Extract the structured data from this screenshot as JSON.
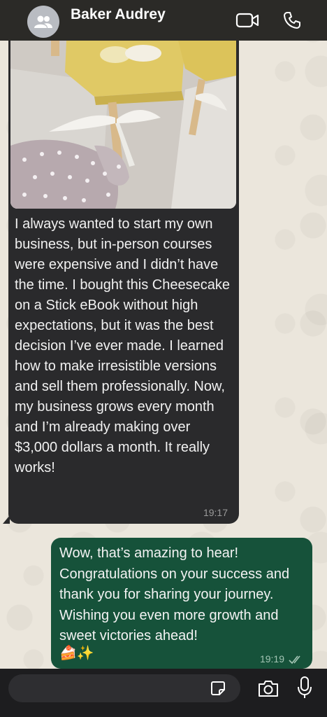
{
  "header": {
    "contact_name": "Baker Audrey",
    "icons": [
      "group-avatar-icon",
      "video-call-icon",
      "phone-call-icon"
    ]
  },
  "messages": [
    {
      "direction": "incoming",
      "has_photo": true,
      "photo_description_icon": "cheesecake-on-stick-photo",
      "text": "I always wanted to start my own business, but in-person courses were expensive and I didn’t have the time. I bought this Cheesecake on a Stick eBook without high expectations, but it was the best decision I’ve ever made. I learned how to make irresistible versions and sell them professionally. Now, my business grows every month and I’m already making over $3,000 dollars a month. It really works!",
      "time": "19:17"
    },
    {
      "direction": "outgoing",
      "text": "Wow, that’s amazing to hear! Congratulations on your success and thank you for sharing your journey. Wishing you even more growth and sweet victories ahead!",
      "emoji": "🍰✨",
      "time": "19:19",
      "status_icon": "double-check-icon"
    }
  ],
  "composer": {
    "input_value": "",
    "icons": [
      "sticker-icon",
      "camera-icon",
      "microphone-icon"
    ]
  },
  "colors": {
    "header_bg": "#2b2a27",
    "incoming_bubble": "#2a2a2c",
    "outgoing_bubble": "#16523a",
    "wallpaper": "#ebe6dc"
  }
}
